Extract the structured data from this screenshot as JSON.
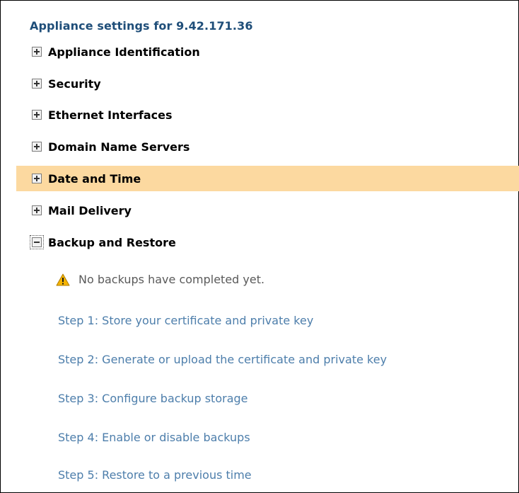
{
  "panel": {
    "title": "Appliance settings for 9.42.171.36"
  },
  "sections": [
    {
      "label": "Appliance Identification",
      "state": "collapsed"
    },
    {
      "label": "Security",
      "state": "collapsed"
    },
    {
      "label": "Ethernet Interfaces",
      "state": "collapsed"
    },
    {
      "label": "Domain Name Servers",
      "state": "collapsed"
    },
    {
      "label": "Date and Time",
      "state": "collapsed",
      "highlighted": true
    },
    {
      "label": "Mail Delivery",
      "state": "collapsed"
    },
    {
      "label": "Backup and Restore",
      "state": "expanded"
    }
  ],
  "backup": {
    "warning_icon": "warning-triangle-icon",
    "warning_text": "No backups have completed yet.",
    "steps": [
      "Step 1: Store your certificate and private key",
      "Step 2: Generate or upload the certificate and private key",
      "Step 3: Configure backup storage",
      "Step 4: Enable or disable backups",
      "Step 5: Restore to a previous time"
    ]
  },
  "colors": {
    "title": "#1f4e79",
    "highlight": "#fcd9a0",
    "step_link": "#4d7eab",
    "warning_icon": "#f5b400"
  }
}
